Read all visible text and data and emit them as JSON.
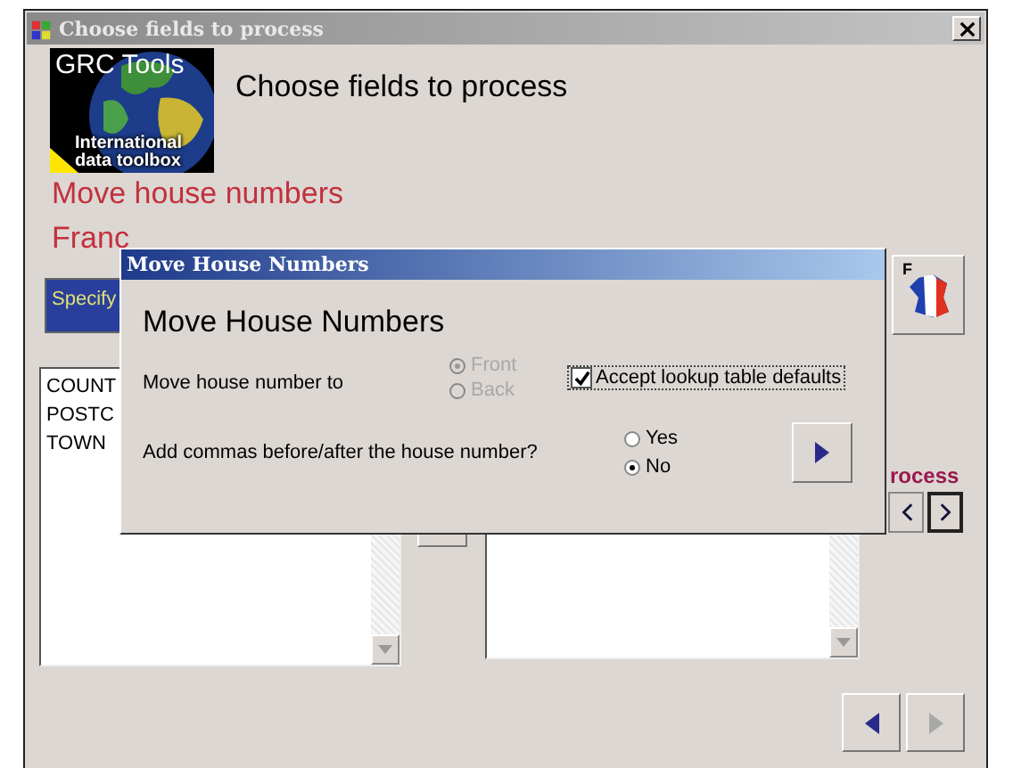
{
  "main_window": {
    "title": "Choose fields to process",
    "logo": {
      "title": "GRC Tools",
      "subtitle": "International data toolbox"
    },
    "heading": "Choose fields to process",
    "task": "Move house numbers",
    "country": "Franc",
    "banner": "Specify",
    "flag_label": "F",
    "source_fields": [
      "COUNT",
      "POSTC",
      "TOWN"
    ],
    "process_label": "rocess",
    "nav_buttons": [
      {
        "kind": "back",
        "disabled": false
      },
      {
        "kind": "forward",
        "disabled": true
      }
    ]
  },
  "dialog": {
    "title": "Move House Numbers",
    "heading": "Move House Numbers",
    "move_label": "Move house number to",
    "position_options": [
      {
        "label": "Front",
        "selected": true,
        "disabled": true
      },
      {
        "label": "Back",
        "selected": false,
        "disabled": true
      }
    ],
    "accept_defaults": {
      "label": "Accept lookup table defaults",
      "checked": true
    },
    "commas_label": "Add commas before/after the house number?",
    "comma_options": [
      {
        "label": "Yes",
        "selected": false
      },
      {
        "label": "No",
        "selected": true
      }
    ]
  }
}
